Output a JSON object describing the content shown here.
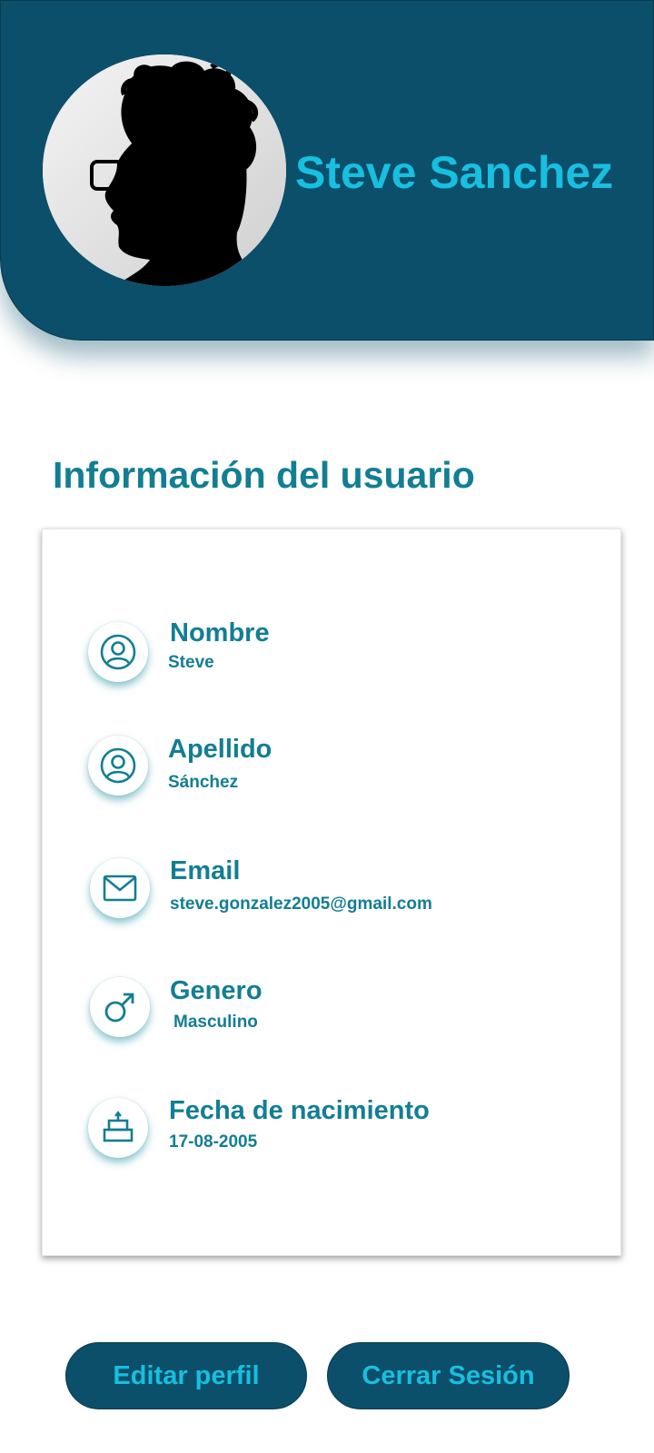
{
  "profile": {
    "name": "Steve Sanchez"
  },
  "section": {
    "title": "Información del usuario"
  },
  "fields": [
    {
      "label": "Nombre",
      "value": "Steve",
      "icon": "user-circle-icon"
    },
    {
      "label": "Apellido",
      "value": "Sánchez",
      "icon": "user-circle-icon"
    },
    {
      "label": "Email",
      "value": "steve.gonzalez2005@gmail.com",
      "icon": "mail-icon"
    },
    {
      "label": "Genero",
      "value": "Masculino",
      "icon": "male-gender-icon"
    },
    {
      "label": "Fecha de nacimiento",
      "value": "17-08-2005",
      "icon": "birthday-cake-icon"
    }
  ],
  "actions": {
    "edit_label": "Editar perfil",
    "logout_label": "Cerrar Sesión"
  },
  "colors": {
    "primary_dark": "#0b4f6a",
    "accent_cyan": "#17bfe0",
    "teal_text": "#127e93"
  }
}
